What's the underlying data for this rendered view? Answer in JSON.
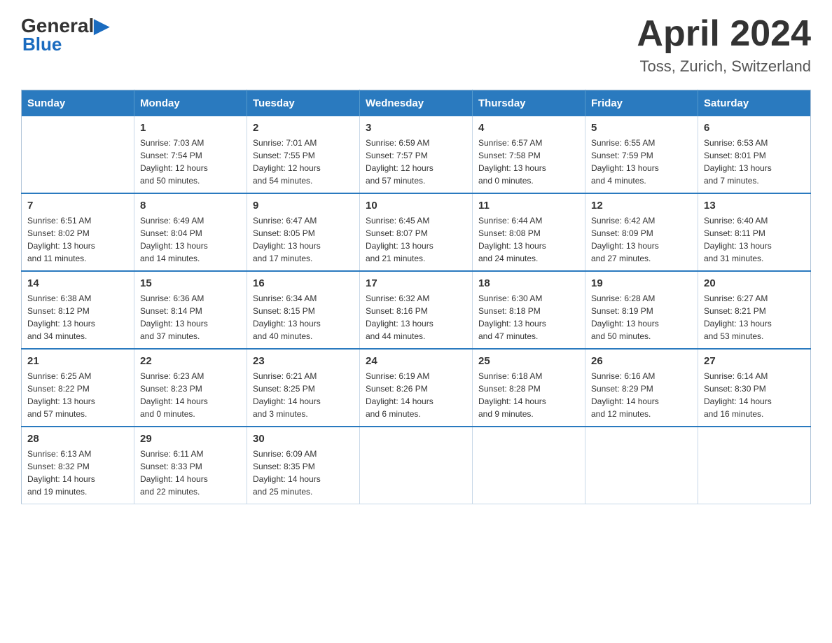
{
  "header": {
    "logo_general": "General",
    "logo_blue": "Blue",
    "month_year": "April 2024",
    "location": "Toss, Zurich, Switzerland"
  },
  "calendar": {
    "days_of_week": [
      "Sunday",
      "Monday",
      "Tuesday",
      "Wednesday",
      "Thursday",
      "Friday",
      "Saturday"
    ],
    "weeks": [
      [
        {
          "day": "",
          "info": ""
        },
        {
          "day": "1",
          "info": "Sunrise: 7:03 AM\nSunset: 7:54 PM\nDaylight: 12 hours\nand 50 minutes."
        },
        {
          "day": "2",
          "info": "Sunrise: 7:01 AM\nSunset: 7:55 PM\nDaylight: 12 hours\nand 54 minutes."
        },
        {
          "day": "3",
          "info": "Sunrise: 6:59 AM\nSunset: 7:57 PM\nDaylight: 12 hours\nand 57 minutes."
        },
        {
          "day": "4",
          "info": "Sunrise: 6:57 AM\nSunset: 7:58 PM\nDaylight: 13 hours\nand 0 minutes."
        },
        {
          "day": "5",
          "info": "Sunrise: 6:55 AM\nSunset: 7:59 PM\nDaylight: 13 hours\nand 4 minutes."
        },
        {
          "day": "6",
          "info": "Sunrise: 6:53 AM\nSunset: 8:01 PM\nDaylight: 13 hours\nand 7 minutes."
        }
      ],
      [
        {
          "day": "7",
          "info": "Sunrise: 6:51 AM\nSunset: 8:02 PM\nDaylight: 13 hours\nand 11 minutes."
        },
        {
          "day": "8",
          "info": "Sunrise: 6:49 AM\nSunset: 8:04 PM\nDaylight: 13 hours\nand 14 minutes."
        },
        {
          "day": "9",
          "info": "Sunrise: 6:47 AM\nSunset: 8:05 PM\nDaylight: 13 hours\nand 17 minutes."
        },
        {
          "day": "10",
          "info": "Sunrise: 6:45 AM\nSunset: 8:07 PM\nDaylight: 13 hours\nand 21 minutes."
        },
        {
          "day": "11",
          "info": "Sunrise: 6:44 AM\nSunset: 8:08 PM\nDaylight: 13 hours\nand 24 minutes."
        },
        {
          "day": "12",
          "info": "Sunrise: 6:42 AM\nSunset: 8:09 PM\nDaylight: 13 hours\nand 27 minutes."
        },
        {
          "day": "13",
          "info": "Sunrise: 6:40 AM\nSunset: 8:11 PM\nDaylight: 13 hours\nand 31 minutes."
        }
      ],
      [
        {
          "day": "14",
          "info": "Sunrise: 6:38 AM\nSunset: 8:12 PM\nDaylight: 13 hours\nand 34 minutes."
        },
        {
          "day": "15",
          "info": "Sunrise: 6:36 AM\nSunset: 8:14 PM\nDaylight: 13 hours\nand 37 minutes."
        },
        {
          "day": "16",
          "info": "Sunrise: 6:34 AM\nSunset: 8:15 PM\nDaylight: 13 hours\nand 40 minutes."
        },
        {
          "day": "17",
          "info": "Sunrise: 6:32 AM\nSunset: 8:16 PM\nDaylight: 13 hours\nand 44 minutes."
        },
        {
          "day": "18",
          "info": "Sunrise: 6:30 AM\nSunset: 8:18 PM\nDaylight: 13 hours\nand 47 minutes."
        },
        {
          "day": "19",
          "info": "Sunrise: 6:28 AM\nSunset: 8:19 PM\nDaylight: 13 hours\nand 50 minutes."
        },
        {
          "day": "20",
          "info": "Sunrise: 6:27 AM\nSunset: 8:21 PM\nDaylight: 13 hours\nand 53 minutes."
        }
      ],
      [
        {
          "day": "21",
          "info": "Sunrise: 6:25 AM\nSunset: 8:22 PM\nDaylight: 13 hours\nand 57 minutes."
        },
        {
          "day": "22",
          "info": "Sunrise: 6:23 AM\nSunset: 8:23 PM\nDaylight: 14 hours\nand 0 minutes."
        },
        {
          "day": "23",
          "info": "Sunrise: 6:21 AM\nSunset: 8:25 PM\nDaylight: 14 hours\nand 3 minutes."
        },
        {
          "day": "24",
          "info": "Sunrise: 6:19 AM\nSunset: 8:26 PM\nDaylight: 14 hours\nand 6 minutes."
        },
        {
          "day": "25",
          "info": "Sunrise: 6:18 AM\nSunset: 8:28 PM\nDaylight: 14 hours\nand 9 minutes."
        },
        {
          "day": "26",
          "info": "Sunrise: 6:16 AM\nSunset: 8:29 PM\nDaylight: 14 hours\nand 12 minutes."
        },
        {
          "day": "27",
          "info": "Sunrise: 6:14 AM\nSunset: 8:30 PM\nDaylight: 14 hours\nand 16 minutes."
        }
      ],
      [
        {
          "day": "28",
          "info": "Sunrise: 6:13 AM\nSunset: 8:32 PM\nDaylight: 14 hours\nand 19 minutes."
        },
        {
          "day": "29",
          "info": "Sunrise: 6:11 AM\nSunset: 8:33 PM\nDaylight: 14 hours\nand 22 minutes."
        },
        {
          "day": "30",
          "info": "Sunrise: 6:09 AM\nSunset: 8:35 PM\nDaylight: 14 hours\nand 25 minutes."
        },
        {
          "day": "",
          "info": ""
        },
        {
          "day": "",
          "info": ""
        },
        {
          "day": "",
          "info": ""
        },
        {
          "day": "",
          "info": ""
        }
      ]
    ]
  }
}
